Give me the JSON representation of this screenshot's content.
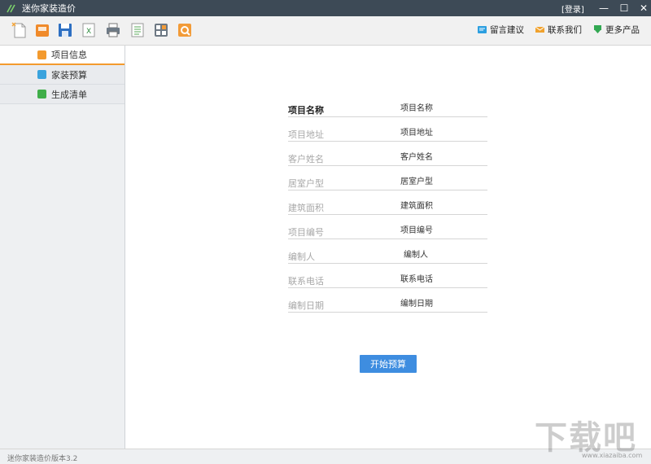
{
  "window": {
    "title": "迷你家装造价",
    "login_label": "[登录]",
    "minimize_glyph": "—",
    "maximize_glyph": "☐",
    "close_glyph": "✕"
  },
  "toolbar": {
    "tools": [
      "new-file-icon",
      "open-folder-icon",
      "save-icon",
      "export-excel-icon",
      "print-icon",
      "list-icon",
      "calculator-icon",
      "settings-icon"
    ],
    "links": [
      {
        "label": "留言建议",
        "icon": "feedback-icon",
        "color": "#2c9fe0"
      },
      {
        "label": "联系我们",
        "icon": "mail-icon",
        "color": "#f0a22e"
      },
      {
        "label": "更多产品",
        "icon": "download-icon",
        "color": "#32a852"
      }
    ]
  },
  "sidebar": {
    "items": [
      {
        "label": "项目信息",
        "icon": "project-info-icon",
        "color": "#f39a2e",
        "active": true
      },
      {
        "label": "家装预算",
        "icon": "budget-icon",
        "color": "#3aa3dd",
        "active": false
      },
      {
        "label": "生成清单",
        "icon": "list-generate-icon",
        "color": "#3fae49",
        "active": false
      }
    ]
  },
  "form": {
    "fields": [
      {
        "label": "项目名称",
        "value": "项目名称"
      },
      {
        "label": "项目地址",
        "value": "项目地址"
      },
      {
        "label": "客户姓名",
        "value": "客户姓名"
      },
      {
        "label": "居室户型",
        "value": "居室户型"
      },
      {
        "label": "建筑面积",
        "value": "建筑面积"
      },
      {
        "label": "项目编号",
        "value": "项目编号"
      },
      {
        "label": "编制人",
        "value": "编制人"
      },
      {
        "label": "联系电话",
        "value": "联系电话"
      },
      {
        "label": "编制日期",
        "value": "编制日期"
      }
    ],
    "start_button": "开始预算"
  },
  "status": {
    "app_name": "迷你家装造价",
    "version": "版本3.2"
  },
  "watermark": {
    "text": "下载吧",
    "url": "www.xiazaiba.com"
  },
  "colors": {
    "titlebar": "#3d4a56",
    "accent": "#3e8de0",
    "active_tab": "#f39a2e"
  }
}
